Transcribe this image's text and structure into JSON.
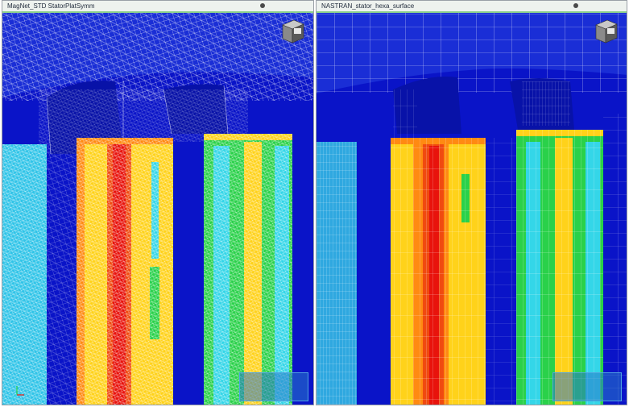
{
  "viewports": [
    {
      "title": "MagNet_STD StatorPlatSymm"
    },
    {
      "title": "NASTRAN_stator_hexa_surface"
    }
  ],
  "colors": {
    "background_blue": "#0a14c8",
    "mesh_line": "#ffffff",
    "hot": "#e8130c",
    "warm": "#ffd21a",
    "mid": "#2ad14a",
    "cool": "#34d6e8",
    "header_accent": "#8cd08c"
  },
  "icons": [
    "view-cube-icon",
    "axis-triad-icon",
    "viewport-menu-dot-icon"
  ]
}
